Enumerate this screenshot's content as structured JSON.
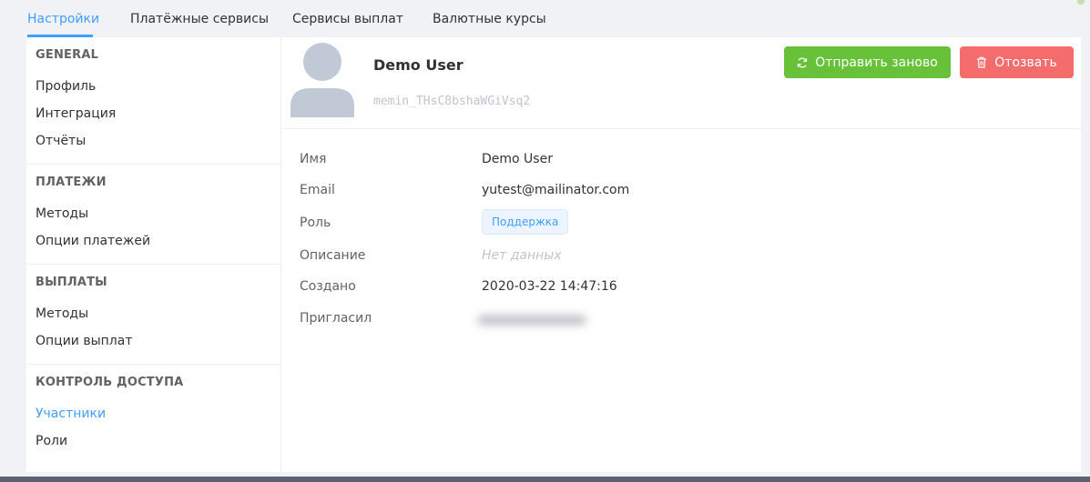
{
  "tabs": [
    {
      "label": "Настройки",
      "active": true
    },
    {
      "label": "Платёжные сервисы",
      "active": false
    },
    {
      "label": "Сервисы выплат",
      "active": false
    },
    {
      "label": "Валютные курсы",
      "active": false
    }
  ],
  "sidebar": {
    "sections": [
      {
        "title": "GENERAL",
        "items": [
          "Профиль",
          "Интеграция",
          "Отчёты"
        ]
      },
      {
        "title": "ПЛАТЕЖИ",
        "items": [
          "Методы",
          "Опции платежей"
        ]
      },
      {
        "title": "ВЫПЛАТЫ",
        "items": [
          "Методы",
          "Опции выплат"
        ]
      },
      {
        "title": "КОНТРОЛЬ ДОСТУПА",
        "items": [
          "Участники",
          "Роли"
        ],
        "active_item": "Участники"
      }
    ]
  },
  "user": {
    "name": "Demo User",
    "id": "memin_THsC8bshaWGiVsq2"
  },
  "actions": {
    "resend_label": "Отправить заново",
    "revoke_label": "Отозвать"
  },
  "details": {
    "name_label": "Имя",
    "name_value": "Demo User",
    "email_label": "Email",
    "email_value": "yutest@mailinator.com",
    "role_label": "Роль",
    "role_value": "Поддержка",
    "description_label": "Описание",
    "description_value": "Нет данных",
    "created_label": "Создано",
    "created_value": "2020-03-22 14:47:16",
    "invited_label": "Пригласил"
  },
  "colors": {
    "accent": "#409eff",
    "success": "#67c23a",
    "danger": "#f56c6c"
  },
  "icons": {
    "resend": "refresh-icon",
    "revoke": "trash-icon",
    "avatar": "user-avatar-icon"
  }
}
